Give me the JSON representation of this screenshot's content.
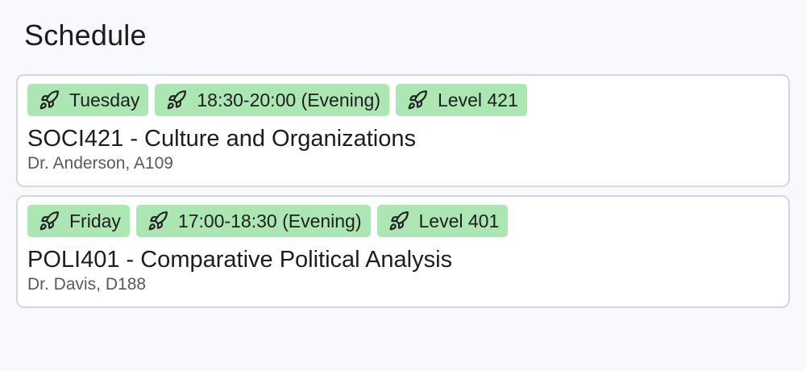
{
  "header": {
    "title": "Schedule"
  },
  "courses": [
    {
      "tags": [
        {
          "icon": "rocket-icon",
          "label": "Tuesday"
        },
        {
          "icon": "rocket-icon",
          "label": "18:30-20:00 (Evening)"
        },
        {
          "icon": "rocket-icon",
          "label": "Level 421"
        }
      ],
      "title": "SOCI421 - Culture and Organizations",
      "meta": "Dr. Anderson, A109"
    },
    {
      "tags": [
        {
          "icon": "rocket-icon",
          "label": "Friday"
        },
        {
          "icon": "rocket-icon",
          "label": "17:00-18:30 (Evening)"
        },
        {
          "icon": "rocket-icon",
          "label": "Level 401"
        }
      ],
      "title": "POLI401 - Comparative Political Analysis",
      "meta": "Dr. Davis, D188"
    }
  ],
  "colors": {
    "tag_background": "#abe6b3",
    "card_border": "#d5d7db",
    "page_background": "#f8f9fd"
  }
}
